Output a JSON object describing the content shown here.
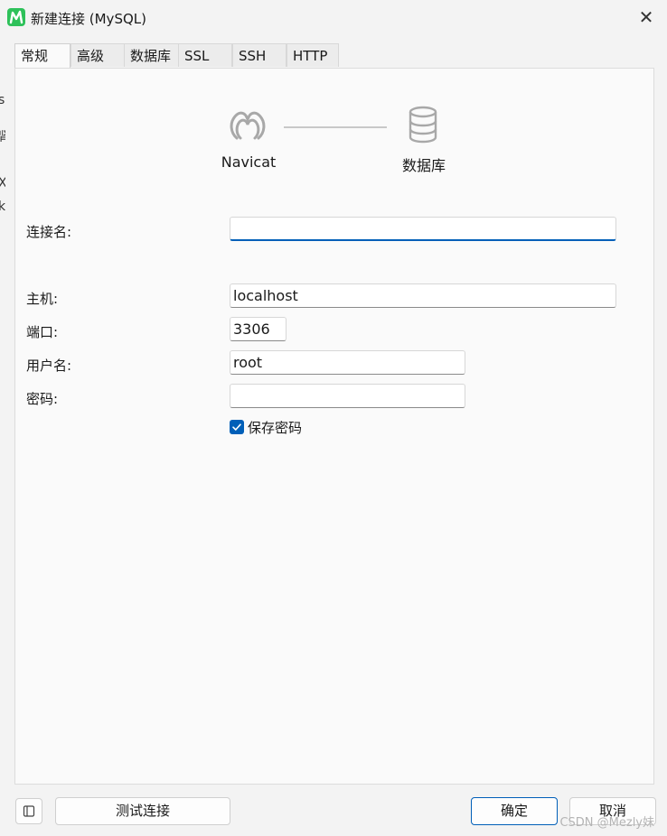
{
  "window": {
    "title": "新建连接 (MySQL)"
  },
  "left_edge_fragments": [
    "s",
    "肾",
    "X",
    "k"
  ],
  "tabs": [
    {
      "label": "常规",
      "active": true
    },
    {
      "label": "高级",
      "active": false
    },
    {
      "label": "数据库",
      "active": false
    },
    {
      "label": "SSL",
      "active": false
    },
    {
      "label": "SSH",
      "active": false
    },
    {
      "label": "HTTP",
      "active": false
    }
  ],
  "diagram": {
    "left_label": "Navicat",
    "right_label": "数据库",
    "left_icon": "navicat-logo-icon",
    "right_icon": "database-icon"
  },
  "form": {
    "connection_name": {
      "label": "连接名:",
      "value": ""
    },
    "host": {
      "label": "主机:",
      "value": "localhost"
    },
    "port": {
      "label": "端口:",
      "value": "3306"
    },
    "username": {
      "label": "用户名:",
      "value": "root"
    },
    "password": {
      "label": "密码:",
      "value": ""
    },
    "save_password": {
      "label": "保存密码",
      "checked": true
    }
  },
  "footer": {
    "test_button": "测试连接",
    "ok_button": "确定",
    "cancel_button": "取消"
  },
  "watermark": "CSDN @Mezly妹",
  "colors": {
    "accent": "#005fb8",
    "app_logo": "#2ec15a"
  }
}
